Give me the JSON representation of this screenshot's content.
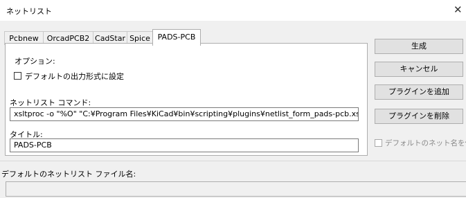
{
  "window": {
    "title": "ネットリスト",
    "close_glyph": "✕"
  },
  "tabs": [
    {
      "label": "Pcbnew",
      "active": false
    },
    {
      "label": "OrcadPCB2",
      "active": false
    },
    {
      "label": "CadStar",
      "active": false
    },
    {
      "label": "Spice",
      "active": false
    },
    {
      "label": "PADS-PCB",
      "active": true
    }
  ],
  "panel": {
    "options_label": "オプション:",
    "default_format_checkbox": {
      "label": "デフォルトの出力形式に設定",
      "checked": false
    },
    "command_label": "ネットリスト コマンド:",
    "command_value": "xsltproc -o \"%O\" \"C:¥Program Files¥KiCad¥bin¥scripting¥plugins¥netlist_form_pads-pcb.xsl\" \"%I\"",
    "title_label": "タイトル:",
    "title_value": "PADS-PCB"
  },
  "buttons": {
    "generate": "生成",
    "cancel": "キャンセル",
    "add_plugin": "プラグインを追加",
    "remove_plugin": "プラグインを削除"
  },
  "use_default_net_name": {
    "label": "デフォルトのネット名を使用",
    "checked": false,
    "enabled": false
  },
  "default_filename_label": "デフォルトのネットリスト ファイル名:",
  "default_filename_value": ""
}
